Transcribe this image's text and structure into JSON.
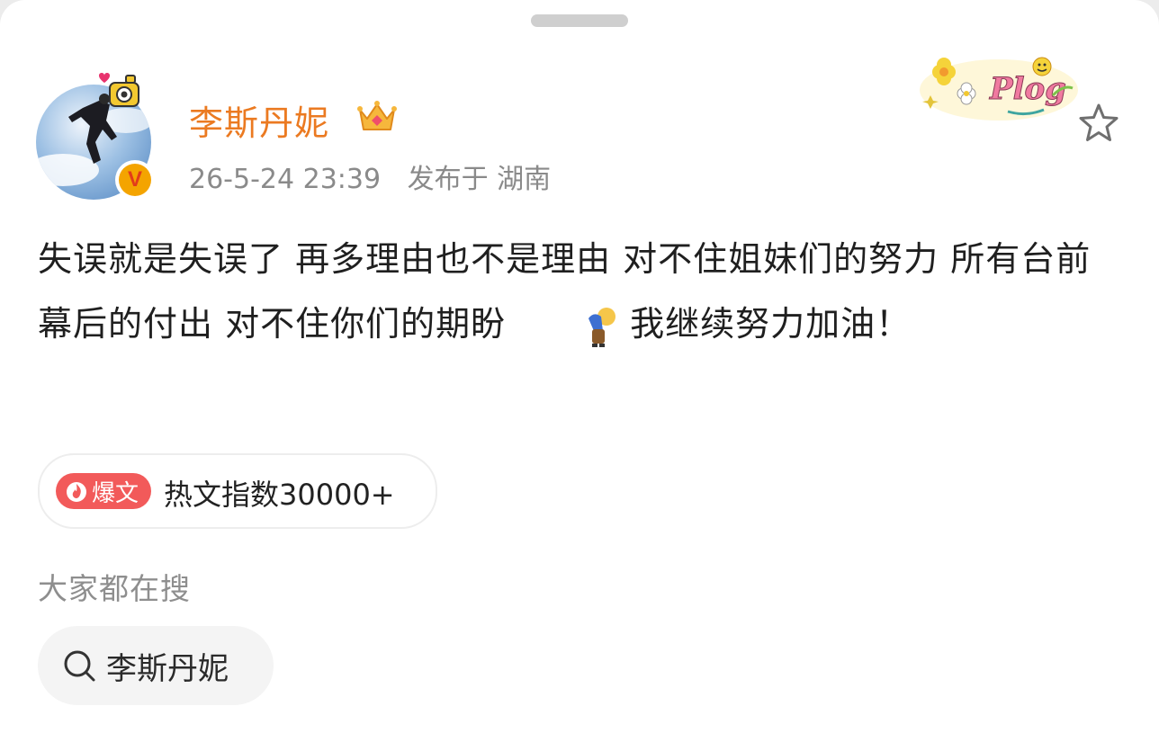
{
  "post": {
    "author": "李斯丹妮",
    "time": "26-5-24 23:39",
    "location": "发布于 湖南",
    "text_part1": "失误就是失误了 再多理由也不是理由 对不住姐妹们的努力 所有台前幕后的付出 对不住你们的期盼",
    "text_part2": "我继续努力加油！",
    "decoration_label": "Plog"
  },
  "hot": {
    "tag": "爆文",
    "text": "热文指数30000+"
  },
  "search": {
    "heading": "大家都在搜",
    "chip_label": "李斯丹妮"
  },
  "colors": {
    "username": "#eb7a21",
    "hot_tag": "#f25a5a",
    "verified_badge": "#f4a400"
  },
  "icons": [
    "crown-icon",
    "verified-v-icon",
    "star-icon",
    "search-icon",
    "flame-icon",
    "bowing-person-emoji",
    "camera-sticker",
    "plog-sticker"
  ]
}
